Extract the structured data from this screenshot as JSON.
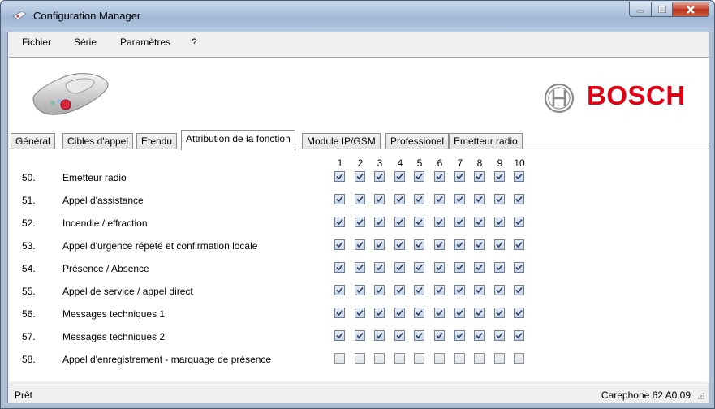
{
  "window": {
    "title": "Configuration Manager",
    "icon": "app-icon"
  },
  "menu": {
    "items": [
      "Fichier",
      "Série",
      "Paramètres",
      "?"
    ]
  },
  "banner": {
    "brand": "BOSCH",
    "brand_color": "#e20015"
  },
  "tabs": [
    {
      "label": "Général",
      "active": false
    },
    {
      "label": "Cibles d'appel",
      "active": false
    },
    {
      "label": "Etendu",
      "active": false
    },
    {
      "label": "Attribution de la fonction",
      "active": true
    },
    {
      "label": "Module IP/GSM",
      "active": false
    },
    {
      "label": "Professionel",
      "active": false
    },
    {
      "label": "Emetteur radio",
      "active": false
    }
  ],
  "grid": {
    "columns": [
      "1",
      "2",
      "3",
      "4",
      "5",
      "6",
      "7",
      "8",
      "9",
      "10"
    ],
    "rows": [
      {
        "num": "50.",
        "label": "Emetteur radio",
        "checked": [
          true,
          true,
          true,
          true,
          true,
          true,
          true,
          true,
          true,
          true
        ]
      },
      {
        "num": "51.",
        "label": "Appel d'assistance",
        "checked": [
          true,
          true,
          true,
          true,
          true,
          true,
          true,
          true,
          true,
          true
        ]
      },
      {
        "num": "52.",
        "label": "Incendie / effraction",
        "checked": [
          true,
          true,
          true,
          true,
          true,
          true,
          true,
          true,
          true,
          true
        ]
      },
      {
        "num": "53.",
        "label": "Appel d'urgence répété et confirmation locale",
        "checked": [
          true,
          true,
          true,
          true,
          true,
          true,
          true,
          true,
          true,
          true
        ]
      },
      {
        "num": "54.",
        "label": "Présence / Absence",
        "checked": [
          true,
          true,
          true,
          true,
          true,
          true,
          true,
          true,
          true,
          true
        ]
      },
      {
        "num": "55.",
        "label": "Appel de service / appel direct",
        "checked": [
          true,
          true,
          true,
          true,
          true,
          true,
          true,
          true,
          true,
          true
        ]
      },
      {
        "num": "56.",
        "label": "Messages techniques 1",
        "checked": [
          true,
          true,
          true,
          true,
          true,
          true,
          true,
          true,
          true,
          true
        ]
      },
      {
        "num": "57.",
        "label": "Messages techniques 2",
        "checked": [
          true,
          true,
          true,
          true,
          true,
          true,
          true,
          true,
          true,
          true
        ]
      },
      {
        "num": "58.",
        "label": "Appel d'enregistrement - marquage de présence",
        "checked": [
          false,
          false,
          false,
          false,
          false,
          false,
          false,
          false,
          false,
          false
        ]
      }
    ]
  },
  "status": {
    "left": "Prêt",
    "right": "Carephone 62 A0.09"
  }
}
